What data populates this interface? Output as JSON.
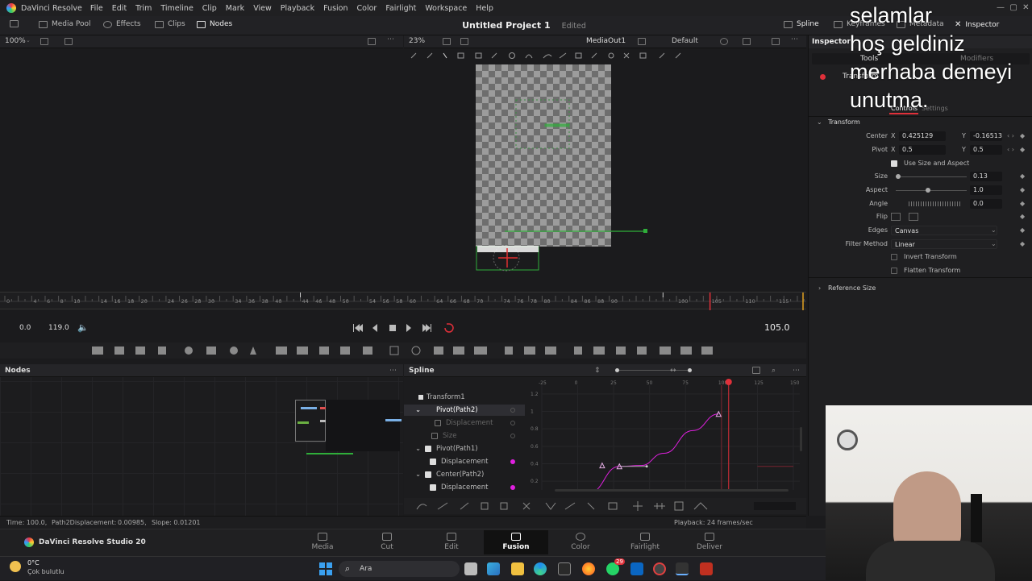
{
  "app": {
    "name": "DaVinci Resolve",
    "menu": [
      "File",
      "Edit",
      "Trim",
      "Timeline",
      "Clip",
      "Mark",
      "View",
      "Playback",
      "Fusion",
      "Color",
      "Fairlight",
      "Workspace",
      "Help"
    ]
  },
  "toolbar": {
    "media_pool": "Media Pool",
    "effects": "Effects",
    "clips": "Clips",
    "nodes": "Nodes",
    "project_title": "Untitled Project 1",
    "project_status": "Edited",
    "spline": "Spline",
    "keyframes": "Keyframes",
    "metadata": "Metadata",
    "inspector": "Inspector"
  },
  "viewer": {
    "left_zoom": "100%",
    "zoom": "23%",
    "output": "MediaOut1",
    "lut": "Default"
  },
  "ruler": {
    "ticks": [
      "0",
      "4",
      "6",
      "8",
      "10",
      "14",
      "16",
      "18",
      "20",
      "24",
      "26",
      "28",
      "30",
      "34",
      "36",
      "38",
      "40",
      "44",
      "46",
      "48",
      "50",
      "54",
      "56",
      "58",
      "60",
      "64",
      "66",
      "68",
      "70",
      "74",
      "76",
      "78",
      "80",
      "84",
      "86",
      "88",
      "90",
      "100",
      "105",
      "110",
      "115"
    ]
  },
  "transport": {
    "start": "0.0",
    "end": "119.0",
    "current": "105.0"
  },
  "panels": {
    "nodes_title": "Nodes",
    "spline_title": "Spline"
  },
  "spline": {
    "items": [
      {
        "label": "Transform1",
        "checked": null,
        "dot": ""
      },
      {
        "label": "Pivot(Path2)",
        "checked": null,
        "dot": "hollow"
      },
      {
        "label": "Displacement",
        "checked": false,
        "dot": "hollow"
      },
      {
        "label": "Size",
        "checked": false,
        "dot": "hollow"
      },
      {
        "label": "Pivot(Path1)",
        "checked": true,
        "dot": ""
      },
      {
        "label": "Displacement",
        "checked": true,
        "dot": "#e020e0"
      },
      {
        "label": "Center(Path2)",
        "checked": true,
        "dot": ""
      },
      {
        "label": "Displacement",
        "checked": true,
        "dot": "#e020e0"
      }
    ],
    "x_ticks": [
      "-25",
      "0",
      "25",
      "50",
      "75",
      "100",
      "125",
      "150"
    ],
    "y_ticks": [
      "1.2",
      "1",
      "0.8",
      "0.6",
      "0.4",
      "0.2"
    ]
  },
  "inspector": {
    "title": "Inspector",
    "tabs": [
      "Tools",
      "Modifiers"
    ],
    "node_name": "Transform",
    "subtabs": [
      "Controls",
      "Settings"
    ],
    "section": "Transform",
    "center_label": "Center",
    "center_x": "0.425129",
    "center_y": "-0.16513",
    "pivot_label": "Pivot",
    "pivot_x": "0.5",
    "pivot_y": "0.5",
    "use_size_aspect": "Use Size and Aspect",
    "size_label": "Size",
    "size": "0.13",
    "aspect_label": "Aspect",
    "aspect": "1.0",
    "angle_label": "Angle",
    "angle": "0.0",
    "flip_label": "Flip",
    "edges_label": "Edges",
    "edges": "Canvas",
    "filter_label": "Filter Method",
    "filter": "Linear",
    "invert": "Invert Transform",
    "flatten": "Flatten Transform",
    "reference_size": "Reference Size",
    "x_axis": "X",
    "y_axis": "Y"
  },
  "status": {
    "time": "Time: 100.0,",
    "path": "Path2Displacement:",
    "value": "0.00985,",
    "slope": "Slope: 0.01201",
    "playback": "Playback: 24 frames/sec"
  },
  "pages": {
    "brand": "DaVinci Resolve Studio 20",
    "tabs": [
      "Media",
      "Cut",
      "Edit",
      "Fusion",
      "Color",
      "Fairlight",
      "Deliver"
    ],
    "active": "Fusion"
  },
  "taskbar": {
    "temp": "0°C",
    "weather": "Çok bulutlu",
    "search": "Ara",
    "badge": "29"
  },
  "overlay": {
    "lines": [
      "selamlar",
      "hoş geldiniz",
      "merhaba demeyi",
      "unutma."
    ]
  },
  "colors": {
    "accent_red": "#e0303a",
    "curve_magenta": "#e020e0",
    "green_outline": "#2fae3a"
  }
}
